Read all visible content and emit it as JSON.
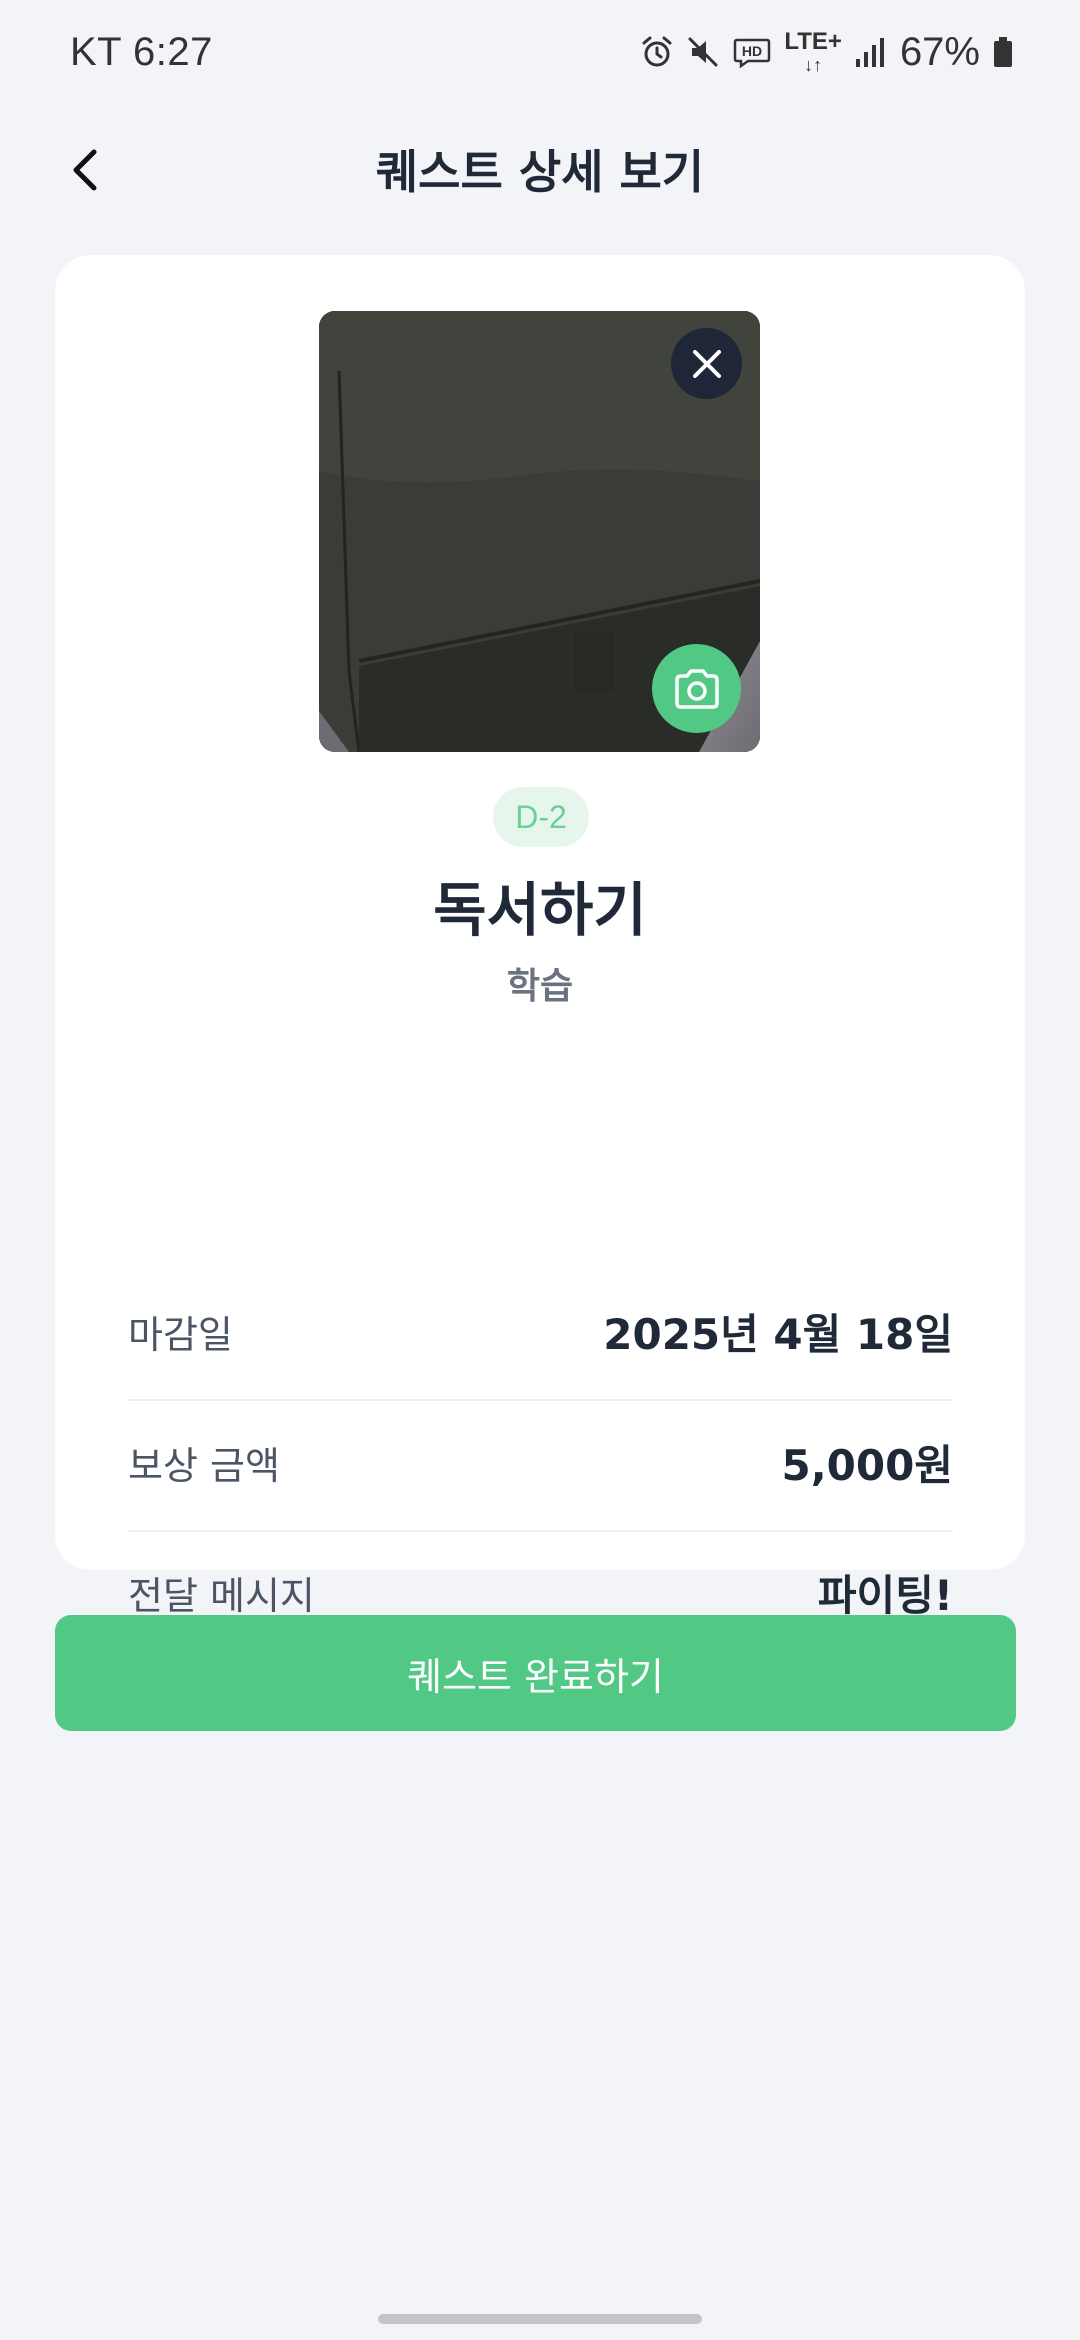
{
  "status_bar": {
    "carrier_time": "KT 6:27",
    "network": "LTE+",
    "network_arrows": "↓↑",
    "battery": "67%"
  },
  "header": {
    "title": "퀘스트 상세 보기"
  },
  "quest": {
    "dday": "D-2",
    "title": "독서하기",
    "category": "학습"
  },
  "details": [
    {
      "label": "마감일",
      "value": "2025년 4월 18일"
    },
    {
      "label": "보상 금액",
      "value": "5,000원"
    },
    {
      "label": "전달 메시지",
      "value": "파이팅!"
    }
  ],
  "actions": {
    "complete_label": "퀘스트 완료하기"
  },
  "colors": {
    "accent": "#51c985",
    "badge_bg": "#e6f6ed",
    "dark_button": "#1e2637",
    "background": "#f3f4f7"
  },
  "icons": [
    "alarm-icon",
    "mute-icon",
    "hd-icon",
    "signal-icon",
    "battery-icon",
    "back-arrow-icon",
    "close-icon",
    "camera-icon"
  ]
}
